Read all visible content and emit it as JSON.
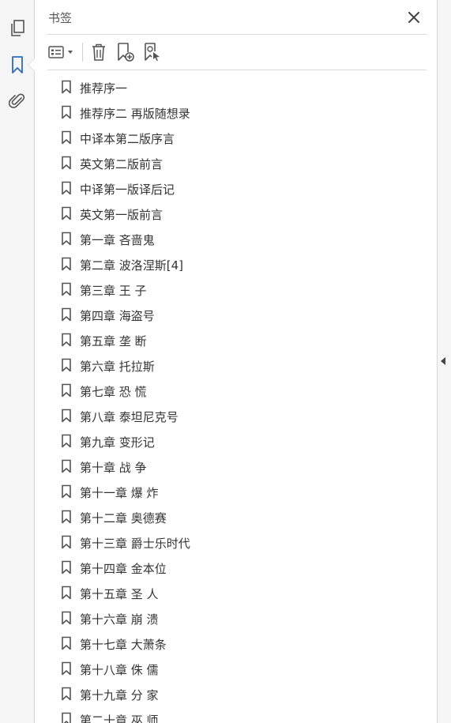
{
  "panel": {
    "title": "书签"
  },
  "bookmarks": [
    {
      "label": "推荐序一"
    },
    {
      "label": "推荐序二 再版随想录"
    },
    {
      "label": "中译本第二版序言"
    },
    {
      "label": "英文第二版前言"
    },
    {
      "label": "中译第一版译后记"
    },
    {
      "label": "英文第一版前言"
    },
    {
      "label": "第一章 吝啬鬼"
    },
    {
      "label": "第二章 波洛涅斯[4]"
    },
    {
      "label": "第三章 王 子"
    },
    {
      "label": "第四章 海盗号"
    },
    {
      "label": "第五章 垄 断"
    },
    {
      "label": "第六章 托拉斯"
    },
    {
      "label": "第七章 恐 慌"
    },
    {
      "label": "第八章 泰坦尼克号"
    },
    {
      "label": "第九章 变形记"
    },
    {
      "label": "第十章 战 争"
    },
    {
      "label": "第十一章 爆 炸"
    },
    {
      "label": "第十二章 奥德赛"
    },
    {
      "label": "第十三章 爵士乐时代"
    },
    {
      "label": "第十四章 金本位"
    },
    {
      "label": "第十五章 圣 人"
    },
    {
      "label": "第十六章 崩 溃"
    },
    {
      "label": "第十七章 大萧条"
    },
    {
      "label": "第十八章 侏 儒"
    },
    {
      "label": "第十九章 分 家"
    },
    {
      "label": "第二十章 巫 师"
    }
  ],
  "colors": {
    "accent": "#2b6cc4",
    "icon": "#555555",
    "text": "#333333"
  }
}
